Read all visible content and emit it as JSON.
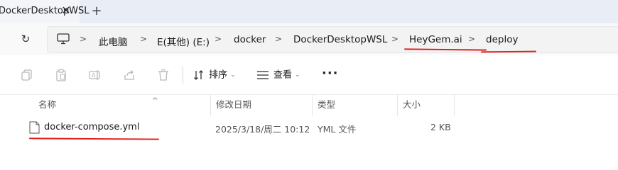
{
  "tab": {
    "title": "DockerDesktopWSL",
    "close_glyph": "✕",
    "new_glyph": "+"
  },
  "address": {
    "refresh_glyph": "↻",
    "separator": ">",
    "crumbs": [
      "此电脑",
      "E(其他) (E:)",
      "docker",
      "DockerDesktopWSL",
      "HeyGem.ai",
      "deploy"
    ]
  },
  "toolbar": {
    "sort_label": "排序",
    "view_label": "查看",
    "more_glyph": "···",
    "chevron": "⌄"
  },
  "columns": [
    "名称",
    "修改日期",
    "类型",
    "大小"
  ],
  "files": [
    {
      "name": "docker-compose.yml",
      "modified": "2025/3/18/周二 10:12",
      "type": "YML 文件",
      "size": "2 KB"
    }
  ],
  "colors": {
    "annotation": "#e0201c",
    "tab_strip": "#e9eef6",
    "address_bar": "#f3f3f3"
  },
  "icons": [
    "computer-icon",
    "copy-icon",
    "paste-icon",
    "rename-icon",
    "share-icon",
    "delete-icon",
    "sort-icon",
    "view-icon",
    "file-icon"
  ]
}
